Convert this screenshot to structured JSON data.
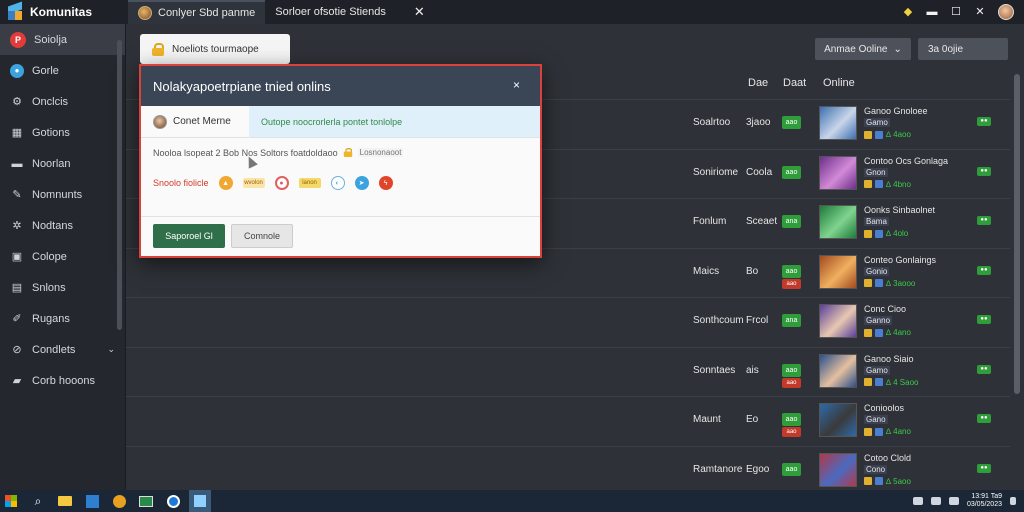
{
  "app": {
    "name": "Komunitas"
  },
  "tabs": [
    {
      "label": "Conlyer Sbd panme",
      "active": true
    },
    {
      "label": "Sorloer ofsotie Stiends",
      "active": false
    }
  ],
  "sidebar": {
    "items": [
      {
        "label": "Soiolja",
        "icon": "badge-icon",
        "active": true
      },
      {
        "label": "Gorle",
        "icon": "globe-icon"
      },
      {
        "label": "Onclcis",
        "icon": "gear-icon"
      },
      {
        "label": "Gotions",
        "icon": "grid-icon"
      },
      {
        "label": "Noorlan",
        "icon": "folder-icon"
      },
      {
        "label": "Nomnunts",
        "icon": "pencil-icon"
      },
      {
        "label": "Nodtans",
        "icon": "cog-icon"
      },
      {
        "label": "Colope",
        "icon": "box-icon"
      },
      {
        "label": "Snlons",
        "icon": "document-icon"
      },
      {
        "label": "Rugans",
        "icon": "pen-icon"
      },
      {
        "label": "Condlets",
        "icon": "link-icon",
        "chevron": "⌄"
      },
      {
        "label": "Corb hooons",
        "icon": "briefcase-icon"
      }
    ]
  },
  "main": {
    "card_label": "Noeliots tourmaope",
    "filter_label": "Anmae Ooline",
    "filter_chevron": "⌄",
    "search_value": "3a 0ojie",
    "columns": {
      "c1": "Dae",
      "c2": "Daat",
      "c3": "Online"
    },
    "rows": [
      {
        "name": "Soalrtoo",
        "num": "3jaoo",
        "badge": "aao",
        "title": "Ganoo Gnoloee",
        "sub": "Gamo",
        "count": "∆ 4aoo",
        "portrait_colors": [
          "#3d6fb0",
          "#c9d6ea"
        ]
      },
      {
        "name": "Soniriome",
        "num": "Coola",
        "badge": "aao",
        "title": "Contoo Ocs Gonlaga",
        "sub": "Gnon",
        "count": "∆ 4bno",
        "portrait_colors": [
          "#6c2f8a",
          "#d28ad8"
        ]
      },
      {
        "name": "Fonlum",
        "num": "Sceaet",
        "badge": "ana",
        "title": "Oonks Sinbaolnet",
        "sub": "Bama",
        "count": "∆ 4olo",
        "portrait_colors": [
          "#1f7a3a",
          "#7fd48f"
        ]
      },
      {
        "name": "Maics",
        "num": "Bo",
        "badge": "aao",
        "badge2": "aao",
        "title": "Conteo Gonlaings",
        "sub": "Gonio",
        "count": "∆ 3aooo",
        "portrait_colors": [
          "#a34a1e",
          "#f0b060"
        ]
      },
      {
        "name": "Sonthcoum",
        "num": "Frcol",
        "badge": "ana",
        "title": "Conc Cioo",
        "sub": "Ganno",
        "count": "∆ 4ano",
        "portrait_colors": [
          "#5a3f9a",
          "#e8c8b0"
        ]
      },
      {
        "name": "Sonntaes",
        "num": "ais",
        "badge": "aao",
        "badge2": "aao",
        "title": "Ganoo Siaio",
        "sub": "Gamo",
        "count": "∆ 4 Saoo",
        "portrait_colors": [
          "#2a4f8a",
          "#e5bfa0"
        ]
      },
      {
        "name": "Maunt",
        "num": "Eo",
        "badge": "aao",
        "badge2": "aao",
        "title": "Conioolos",
        "sub": "Gano",
        "count": "∆ 4ano",
        "portrait_colors": [
          "#2d6aa8",
          "#3a3a3a"
        ]
      },
      {
        "name": "Ramtanore",
        "num": "Egoo",
        "badge": "aao",
        "title": "Cotoo Clold",
        "sub": "Cono",
        "count": "∆ 5aoo",
        "portrait_colors": [
          "#b03a4a",
          "#4a6ac0"
        ]
      }
    ]
  },
  "modal": {
    "title": "Nolakyapoetrpiane tnied onlins",
    "close": "×",
    "user_name": "Conet Merne",
    "user_status": "Outope noocrorlerla pontet tonlolpe",
    "description": "Nooloa lsopeat 2 Bob Nos Soltors foatdoldaoo",
    "description_flag": "Losnonaoot",
    "share_label": "Snoolo fiolicle",
    "share_tag_1": "wvolon",
    "share_tag_2": "lanon",
    "primary_button": "Saporoel Gl",
    "secondary_button": "Comnole"
  },
  "taskbar": {
    "clock_time": "13:91 Ta9",
    "clock_date": "03/05/2023"
  },
  "colors": {
    "accent_green": "#2f9d3a",
    "modal_border": "#d9413a",
    "modal_header": "#3a4556"
  }
}
